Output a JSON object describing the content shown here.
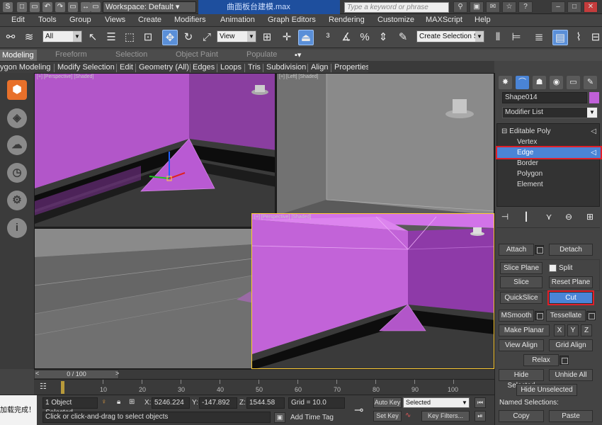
{
  "titlebar": {
    "workspace": "Workspace: Default",
    "document": "曲面板台建模.max",
    "search_placeholder": "Type a keyword or phrase",
    "quick_icons": [
      "S",
      "□",
      "▭",
      "↶",
      "↷",
      "▭",
      "↔",
      "▭"
    ]
  },
  "menus": [
    "Edit",
    "Tools",
    "Group",
    "Views",
    "Create",
    "Modifiers",
    "Animation",
    "Graph Editors",
    "Rendering",
    "Customize",
    "MAXScript",
    "Help"
  ],
  "main_toolbar": {
    "selection_filter": "All",
    "ref_coord": "View",
    "named_selection_placeholder": "Create Selection Se"
  },
  "ribbon": {
    "tabs": [
      "Modeling",
      "Freeform",
      "Selection",
      "Object Paint",
      "Populate"
    ],
    "panels": [
      "ygon Modeling",
      "Modify Selection",
      "Edit",
      "Geometry (All)",
      "Edges",
      "Loops",
      "Tris",
      "Subdivision",
      "Align",
      "Properties"
    ]
  },
  "viewports": {
    "top_left_label": "[+] [Perspective] [Shaded]",
    "top_right_label": "[+] [Left] [Shaded]",
    "bottom_right_label": "[+] [Perspective] [Shaded]"
  },
  "command_panel": {
    "object_name": "Shape014",
    "object_color": "#c060d8",
    "modifier_list": "Modifier List",
    "stack": {
      "root": "Editable Poly",
      "items": [
        "Vertex",
        "Edge",
        "Border",
        "Polygon",
        "Element"
      ],
      "selected": "Edge"
    },
    "buttons": {
      "attach": "Attach",
      "detach": "Detach",
      "slice_plane": "Slice Plane",
      "split": "Split",
      "slice": "Slice",
      "reset_plane": "Reset Plane",
      "quickslice": "QuickSlice",
      "cut": "Cut",
      "msmooth": "MSmooth",
      "tessellate": "Tessellate",
      "make_planar": "Make Planar",
      "x": "X",
      "y": "Y",
      "z": "Z",
      "view_align": "View Align",
      "grid_align": "Grid Align",
      "relax": "Relax",
      "hide_selected": "Hide Selected",
      "unhide_all": "Unhide All",
      "hide_unselected": "Hide Unselected",
      "named_selections": "Named Selections:",
      "copy": "Copy",
      "paste": "Paste"
    }
  },
  "timeline": {
    "frame_display": "0 / 100",
    "ticks": [
      "10",
      "20",
      "30",
      "40",
      "50",
      "60",
      "70",
      "80",
      "90",
      "100"
    ]
  },
  "status": {
    "message_cn": "加载完成！",
    "selection_count": "1 Object Selected",
    "prompt": "Click or click-and-drag to select objects",
    "x_label": "X:",
    "x": "5246.224",
    "y_label": "Y:",
    "y": "-147.892",
    "z_label": "Z:",
    "z": "1544.58",
    "grid": "Grid = 10.0",
    "add_time_tag": "Add Time Tag",
    "auto_key": "Auto Key",
    "set_key": "Set Key",
    "key_filter_sel": "Selected",
    "key_filters": "Key Filters..."
  }
}
